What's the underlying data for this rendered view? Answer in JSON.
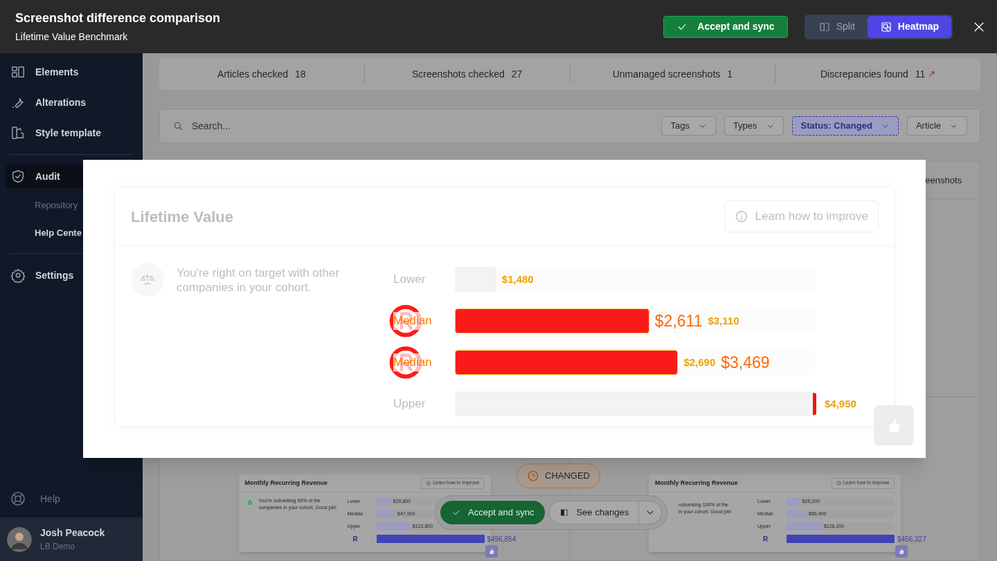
{
  "header": {
    "title": "Screenshot difference comparison",
    "subtitle": "Lifetime Value Benchmark",
    "accept_button": "Accept and sync",
    "view_modes": [
      {
        "label": "Split",
        "selected": false,
        "kind": "split"
      },
      {
        "label": "Heatmap",
        "selected": true,
        "kind": "heatmap"
      }
    ]
  },
  "sidebar": {
    "items": [
      {
        "label": "Elements",
        "kind": "elements",
        "selected": false
      },
      {
        "label": "Alterations",
        "kind": "alterations",
        "selected": false
      },
      {
        "label": "Style template",
        "kind": "style",
        "selected": false
      },
      {
        "label": "Audit",
        "kind": "audit",
        "selected": true,
        "children": [
          {
            "label": "Repository",
            "selected": false
          },
          {
            "label": "Help Cente",
            "selected": true
          }
        ]
      },
      {
        "label": "Settings",
        "kind": "settings",
        "selected": false
      }
    ],
    "help": "Help",
    "user": {
      "name": "Josh Peacock",
      "org": "LB Demo"
    }
  },
  "stats": [
    {
      "label": "Articles checked",
      "value": "18"
    },
    {
      "label": "Screenshots checked",
      "value": "27"
    },
    {
      "label": "Unmanaged screenshots",
      "value": "1"
    },
    {
      "label": "Discrepancies found",
      "value": "11",
      "trend": "↗"
    }
  ],
  "filters": {
    "search_placeholder": "Search...",
    "dropdowns": [
      {
        "label": "Tags",
        "selected": false
      },
      {
        "label": "Types",
        "selected": false
      },
      {
        "label": "Status: Changed",
        "selected": true
      },
      {
        "label": "Article",
        "selected": false
      }
    ]
  },
  "table": {
    "column_cut": "eenshots"
  },
  "heatmap": {
    "title": "Lifetime Value",
    "learn_button": "Learn how to improve",
    "message": "You're right on target with other companies in your cohort.",
    "rows": [
      {
        "label": "Lower",
        "changed": false,
        "level": 0.115,
        "values": [
          {
            "text": "$1,480",
            "kind": "old"
          }
        ]
      },
      {
        "label": "Median",
        "changed": true,
        "level": 0.54,
        "values": [
          {
            "text": "$2,611",
            "kind": "new"
          },
          {
            "text": "$3,110",
            "kind": "old"
          }
        ]
      },
      {
        "label": "Median",
        "changed": true,
        "level": 0.62,
        "values": [
          {
            "text": "$2,690",
            "kind": "old"
          },
          {
            "text": "$3,469",
            "kind": "new"
          }
        ]
      },
      {
        "label": "Upper",
        "changed": false,
        "level": 1,
        "values": [
          {
            "text": "$4,950",
            "kind": "old"
          }
        ]
      }
    ]
  },
  "comparison": {
    "status": "CHANGED",
    "accept_button": "Accept and sync",
    "see_changes_button": "See changes",
    "cards": [
      {
        "title": "Monthly Recurring Revenue",
        "learn_button": "Learn how to improve",
        "message": [
          "You're outranking 99% of the",
          "companies in your cohort. Good job!"
        ],
        "rows": [
          {
            "label": "Lower",
            "value": "$20,600",
            "level": 0.13
          },
          {
            "label": "Median",
            "value": "$47,900",
            "level": 0.17
          },
          {
            "label": "Upper",
            "value": "$123,800",
            "level": 0.31
          },
          {
            "label": "R",
            "value": "$496,854",
            "level": 1,
            "kind": "highlight"
          }
        ]
      },
      {
        "title": "Monthly Recurring Revenue",
        "learn_button": "Learn how to improve",
        "message": [
          "outranking 100% of the",
          "in your cohort. Good job!"
        ],
        "rows": [
          {
            "label": "Lower",
            "value": "$25,200",
            "level": 0.12
          },
          {
            "label": "Median",
            "value": "$56,400",
            "level": 0.18
          },
          {
            "label": "Upper",
            "value": "$126,200",
            "level": 0.32
          },
          {
            "label": "R",
            "value": "$456,327",
            "level": 1,
            "kind": "highlight"
          }
        ]
      }
    ]
  }
}
